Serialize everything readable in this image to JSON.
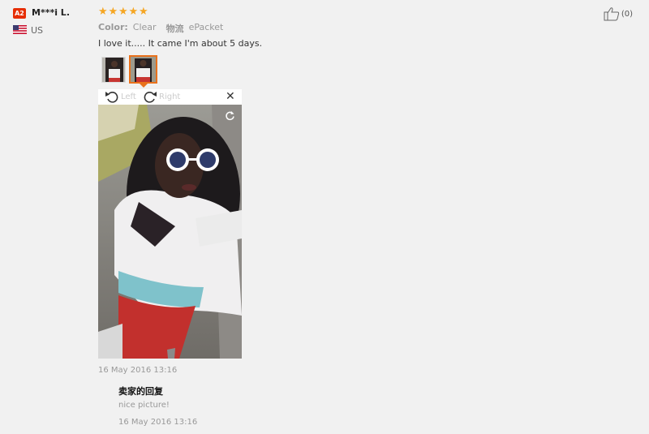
{
  "reviewer": {
    "badge": "A2",
    "name": "M***i L.",
    "country": "US"
  },
  "review": {
    "rating": 5,
    "stars": [
      "★",
      "★",
      "★",
      "★",
      "★"
    ],
    "color_label": "Color:",
    "color_value": "Clear",
    "shipping_label": "物流",
    "shipping_value": "ePacket",
    "text": "I love it..... It came I'm about 5 days.",
    "date": "16 May 2016 13:16",
    "likes": "(0)"
  },
  "viewer": {
    "rotate_left_label": "Left",
    "rotate_right_label": "Right",
    "close_symbol": "✕"
  },
  "seller_reply": {
    "title": "卖家的回复",
    "text": "nice picture!",
    "date": "16 May 2016 13:16"
  },
  "colors": {
    "star": "#f5a623",
    "badge": "#e62e04",
    "selected_thumb_border": "#e9711c"
  }
}
